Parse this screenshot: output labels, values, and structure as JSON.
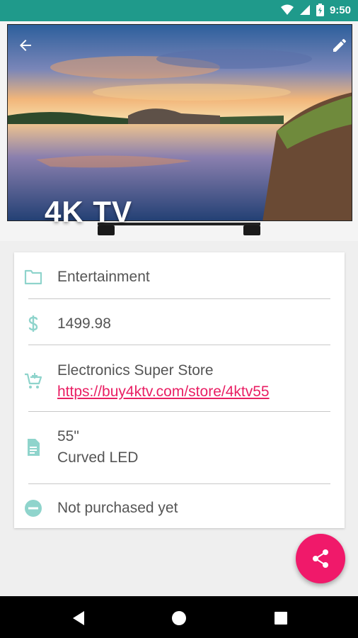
{
  "status_bar": {
    "time": "9:50",
    "battery_level": "charging"
  },
  "hero": {
    "title": "4K TV",
    "back_icon": "arrow-back-icon",
    "edit_icon": "pencil-icon"
  },
  "details": {
    "category": "Entertainment",
    "price": "1499.98",
    "store_name": "Electronics Super Store",
    "store_url": "https://buy4ktv.com/store/4ktv55",
    "notes_line1": "55\"",
    "notes_line2": "Curved LED",
    "status": "Not purchased yet"
  },
  "icons": {
    "category": "folder-icon",
    "price": "dollar-icon",
    "store": "add-shopping-cart-icon",
    "notes": "document-icon",
    "status": "minus-circle-icon",
    "fab": "share-icon"
  },
  "colors": {
    "primary": "#1f9a8b",
    "accent": "#f0196a",
    "icon_tint": "#8fd4cc",
    "link": "#e91e63"
  },
  "nav_bar": {
    "back": "back-triangle-icon",
    "home": "home-circle-icon",
    "recents": "recents-square-icon"
  }
}
